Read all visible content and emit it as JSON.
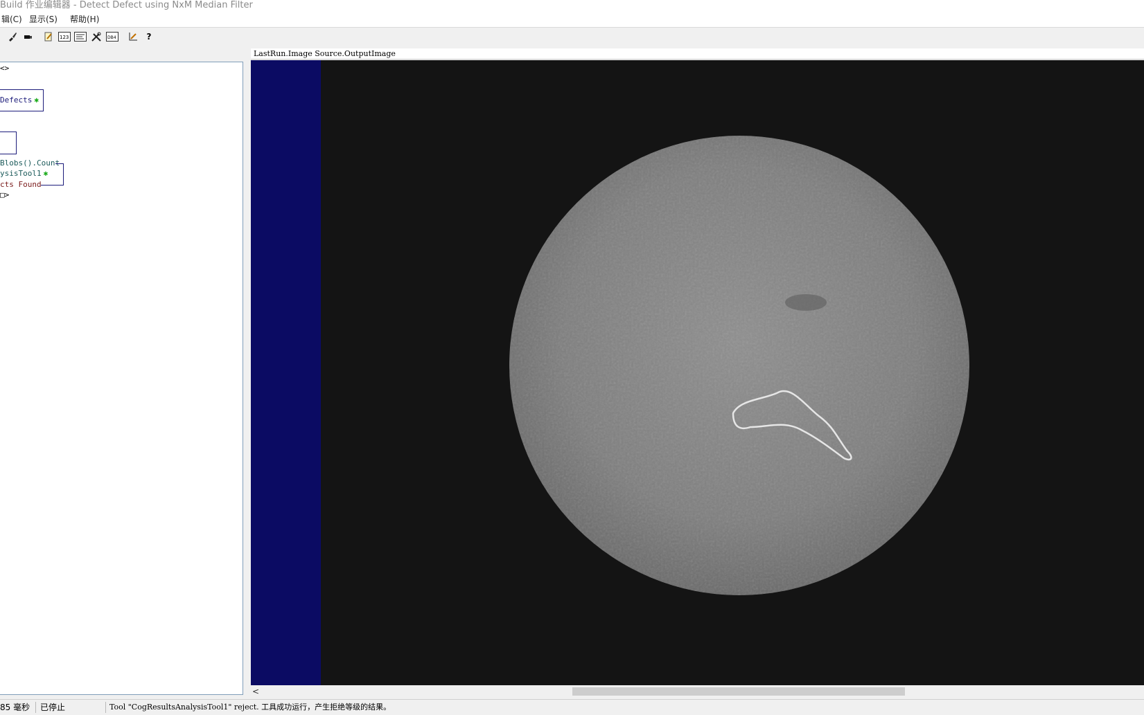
{
  "window": {
    "title": "Build 作业编辑器 - Detect Defect using NxM Median Filter"
  },
  "menu": {
    "items": [
      "辑(C)",
      "显示(S)",
      "帮助(H)"
    ]
  },
  "toolbar": {
    "buttons": [
      "brush-icon",
      "plug-icon",
      "edit-script-icon",
      "number-128-icon",
      "terminal-icon",
      "tools-icon",
      "db-icon",
      "scale-icon",
      "help-icon"
    ],
    "number_icon_text": "123",
    "db_icon_text": "DB4",
    "help_text": "?"
  },
  "tree": {
    "nodes": [
      {
        "label": "<>"
      },
      {
        "label": "Defects",
        "star": true
      },
      {
        "label": "Blobs().Count"
      },
      {
        "label": "ysisTool1",
        "star": true
      },
      {
        "label": "cts Found"
      },
      {
        "label": "□>"
      }
    ]
  },
  "display": {
    "title": "LastRun.Image Source.OutputImage"
  },
  "colors": {
    "viewport_background": "#0b0b63",
    "image_background": "#141414",
    "tree_connector": "#1b1b7a",
    "modified_star": "#1aaa1a"
  },
  "scrollbar": {
    "left_arrow": "<"
  },
  "statusbar": {
    "time": "85 毫秒",
    "state": "已停止",
    "message": "Tool \"CogResultsAnalysisTool1\" reject. 工具成功运行，产生拒绝等级的结果。"
  }
}
